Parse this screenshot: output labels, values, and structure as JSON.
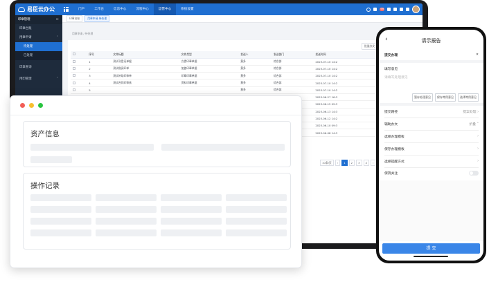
{
  "app": {
    "name": "易臣云办公",
    "nav": [
      "门户",
      "工作台",
      "信息中心",
      "流程中心",
      "运营中心",
      "系统设置"
    ],
    "active_nav": "运营中心",
    "notification_count": "99"
  },
  "sidebar": {
    "header": "印章管理",
    "items": [
      {
        "label": "印章台账",
        "type": "item"
      },
      {
        "label": "用章申请",
        "type": "group"
      },
      {
        "label": "待处理",
        "type": "sub-active"
      },
      {
        "label": "已处理",
        "type": "sub"
      },
      {
        "label": "印章查询",
        "type": "item"
      },
      {
        "label": "用印管理",
        "type": "group"
      }
    ]
  },
  "tabs": [
    "印章台账",
    "用章申请-待处理"
  ],
  "breadcrumb": "用章申请 / 待处理",
  "toolbar": [
    "批量办文",
    "新增办文",
    "筛选"
  ],
  "table": {
    "columns": [
      "序号",
      "文件标题",
      "文件类型",
      "发送人",
      "发送部门",
      "发送时间"
    ],
    "rows": [
      [
        "1",
        "测试刊登证单据",
        "方提印章单据",
        "黄多",
        "综合部",
        "2023-07-10 14:2"
      ],
      [
        "2",
        "测试借阅印单",
        "加盖印章单据",
        "黄多",
        "综合部",
        "2023-07-10 14:2"
      ],
      [
        "3",
        "测试补助印审单",
        "印章印章单据",
        "黄多",
        "综合部",
        "2023-07-10 14:2"
      ],
      [
        "4",
        "测试合同印审核",
        "资料印章单据",
        "黄多",
        "综合部",
        "2023-07-10 14:2"
      ],
      [
        "5",
        "",
        "",
        "黄多",
        "综合部",
        "2023-07-10 14:2"
      ],
      [
        "6",
        "",
        "",
        "黄多",
        "公司领导",
        "2023-06-27 16:3"
      ],
      [
        "7",
        "",
        "",
        "黄多",
        "综合部",
        "2023-06-15 09:3"
      ],
      [
        "8",
        "",
        "",
        "黄多",
        "公司领导",
        "2023-06-13 14:3"
      ],
      [
        "9",
        "",
        "",
        "黄多",
        "公司领导",
        "2023-06-12 14:2"
      ],
      [
        "10",
        "",
        "",
        "黄多",
        "公司领导",
        "2023-06-10 09:3"
      ],
      [
        "11",
        "",
        "",
        "黄多",
        "综合部",
        "2023-06-08 14:3"
      ]
    ]
  },
  "pager": {
    "size": "10条/页",
    "pages": [
      "1",
      "2",
      "3",
      "4"
    ],
    "current": "1"
  },
  "window": {
    "section1_title": "资产信息",
    "section2_title": "操作记录"
  },
  "phone": {
    "title": "请示报告",
    "submit_header": "提交办理",
    "opinion_label": "填写意见",
    "opinion_placeholder": "请填写处理意见",
    "buttons": [
      "暂存处理意见",
      "保存常用意见",
      "选择常用意见"
    ],
    "route_label": "提交路径",
    "route_value": "提案处理",
    "assist_label": "辅助办文",
    "assist_value": "折叠",
    "options": [
      "选择办理模板",
      "保存办理模板",
      "选择提醒方式"
    ],
    "follow_label": "保持关注",
    "submit_button": "提 交"
  },
  "colors": {
    "primary": "#1f6fd1",
    "sidebar": "#1e2b3c",
    "submit": "#3a86e8"
  }
}
